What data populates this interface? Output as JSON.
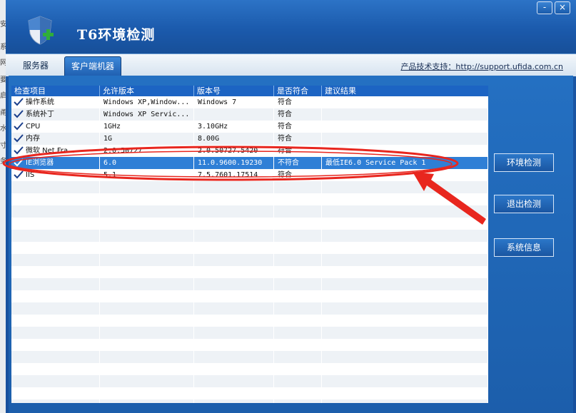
{
  "app": {
    "title": "T6环境检测"
  },
  "window_controls": {
    "minimize": "-",
    "close": "×"
  },
  "background_chars": [
    "安",
    "系",
    "网",
    "要",
    "启",
    "甬",
    "水",
    "寸",
    "务"
  ],
  "tabs": [
    {
      "label": "服务器",
      "active": false
    },
    {
      "label": "客户端机器",
      "active": true
    }
  ],
  "support": {
    "text": "产品技术支持：http://support.ufida.com.cn"
  },
  "table": {
    "columns": [
      "检查项目",
      "允许版本",
      "版本号",
      "是否符合",
      "建议结果"
    ],
    "rows": [
      {
        "item": "操作系统",
        "allowed": "Windows XP,Window...",
        "version": "Windows 7",
        "ok": "符合",
        "advice": "",
        "status": "pass"
      },
      {
        "item": "系统补丁",
        "allowed": "Windows XP Servic...",
        "version": "",
        "ok": "符合",
        "advice": "",
        "status": "pass"
      },
      {
        "item": "CPU",
        "allowed": "1GHz",
        "version": "3.10GHz",
        "ok": "符合",
        "advice": "",
        "status": "pass"
      },
      {
        "item": "内存",
        "allowed": "1G",
        "version": "8.00G",
        "ok": "符合",
        "advice": "",
        "status": "pass"
      },
      {
        "item": "微软  Net Fra...",
        "allowed": "2.0.50727",
        "version": "2.0.50727.5420",
        "ok": "符合",
        "advice": "",
        "status": "pass"
      },
      {
        "item": "IE浏览器",
        "allowed": "6.0",
        "version": "11.0.9600.19230",
        "ok": "不符合",
        "advice": "最低IE6.0 Service Pack 1",
        "status": "fail"
      },
      {
        "item": "IIS",
        "allowed": "5.1",
        "version": "7.5.7601.17514",
        "ok": "符合",
        "advice": "",
        "status": "pass"
      }
    ]
  },
  "buttons": {
    "check_env": "环境检测",
    "exit_check": "退出检测",
    "system_info": "系统信息"
  },
  "colors": {
    "annotation": "#e8261e",
    "selected_row": "#2f7fd6",
    "header": "#1c64c3"
  }
}
